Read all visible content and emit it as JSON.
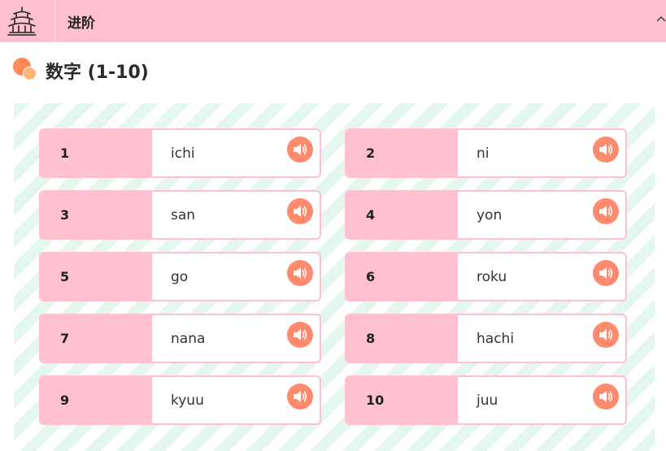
{
  "header": {
    "title": "进阶",
    "logo_icon": "pagoda-icon",
    "collapse_icon": "chevron-up-icon"
  },
  "section": {
    "title": "数字 (1-10)"
  },
  "cards": [
    {
      "number": "1",
      "romaji": "ichi"
    },
    {
      "number": "2",
      "romaji": "ni"
    },
    {
      "number": "3",
      "romaji": "san"
    },
    {
      "number": "4",
      "romaji": "yon"
    },
    {
      "number": "5",
      "romaji": "go"
    },
    {
      "number": "6",
      "romaji": "roku"
    },
    {
      "number": "7",
      "romaji": "nana"
    },
    {
      "number": "8",
      "romaji": "hachi"
    },
    {
      "number": "9",
      "romaji": "kyuu"
    },
    {
      "number": "10",
      "romaji": "juu"
    }
  ],
  "colors": {
    "header_bg": "#ffc0cf",
    "speaker_button": "#ff8a6e",
    "stripe": "#e4f7ee"
  }
}
